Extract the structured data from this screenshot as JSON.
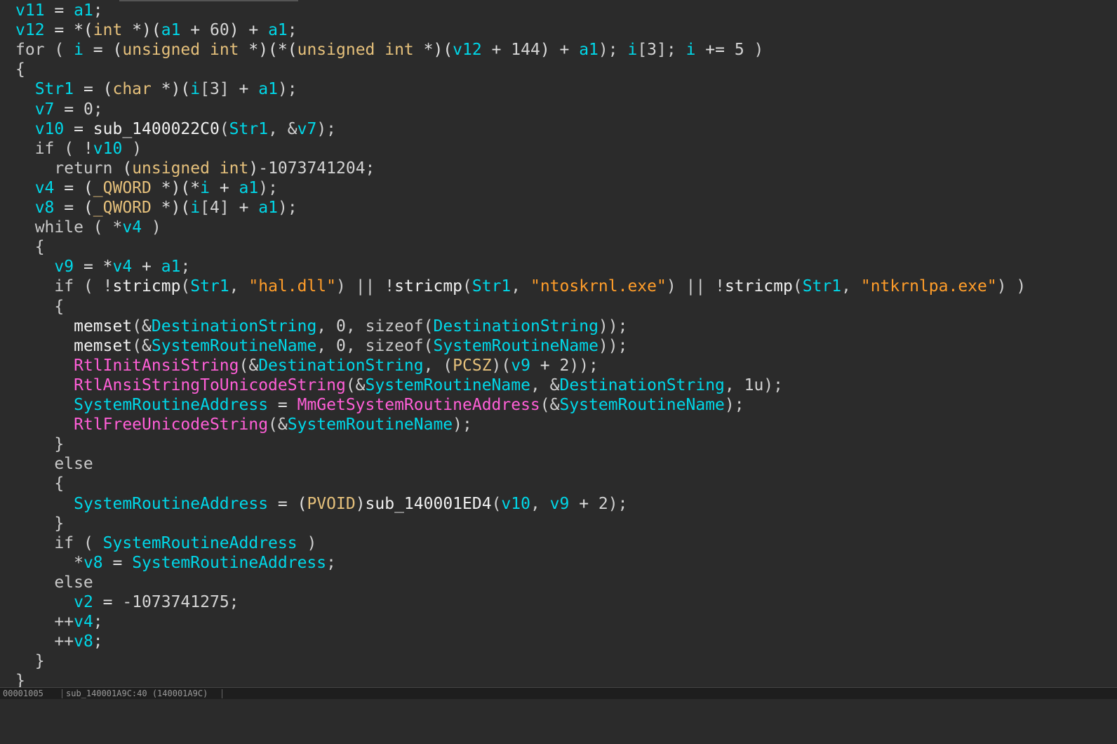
{
  "code_lines": [
    [
      [
        "var",
        "v11"
      ],
      [
        "op",
        " = "
      ],
      [
        "var",
        "a1"
      ],
      [
        "pun",
        ";"
      ]
    ],
    [
      [
        "var",
        "v12"
      ],
      [
        "op",
        " = *("
      ],
      [
        "ty",
        "int"
      ],
      [
        "op",
        " *)("
      ],
      [
        "var",
        "a1"
      ],
      [
        "op",
        " + "
      ],
      [
        "num",
        "60"
      ],
      [
        "op",
        ") + "
      ],
      [
        "var",
        "a1"
      ],
      [
        "pun",
        ";"
      ]
    ],
    [
      [
        "kw",
        "for"
      ],
      [
        "pun",
        " ( "
      ],
      [
        "var",
        "i"
      ],
      [
        "op",
        " = ("
      ],
      [
        "ty",
        "unsigned int"
      ],
      [
        "op",
        " *)(*("
      ],
      [
        "ty",
        "unsigned int"
      ],
      [
        "op",
        " *)("
      ],
      [
        "var",
        "v12"
      ],
      [
        "op",
        " + "
      ],
      [
        "num",
        "144"
      ],
      [
        "op",
        ") + "
      ],
      [
        "var",
        "a1"
      ],
      [
        "pun",
        "); "
      ],
      [
        "var",
        "i"
      ],
      [
        "pun",
        "["
      ],
      [
        "num",
        "3"
      ],
      [
        "pun",
        "]; "
      ],
      [
        "var",
        "i"
      ],
      [
        "op",
        " += "
      ],
      [
        "num",
        "5"
      ],
      [
        "pun",
        " )"
      ]
    ],
    [
      [
        "pun",
        "{"
      ]
    ],
    [
      [
        "pun",
        "  "
      ],
      [
        "var",
        "Str1"
      ],
      [
        "op",
        " = ("
      ],
      [
        "ty",
        "char"
      ],
      [
        "op",
        " *)("
      ],
      [
        "var",
        "i"
      ],
      [
        "pun",
        "["
      ],
      [
        "num",
        "3"
      ],
      [
        "pun",
        "]"
      ],
      [
        "op",
        " + "
      ],
      [
        "var",
        "a1"
      ],
      [
        "pun",
        ");"
      ]
    ],
    [
      [
        "pun",
        "  "
      ],
      [
        "var",
        "v7"
      ],
      [
        "op",
        " = "
      ],
      [
        "num",
        "0"
      ],
      [
        "pun",
        ";"
      ]
    ],
    [
      [
        "pun",
        "  "
      ],
      [
        "var",
        "v10"
      ],
      [
        "op",
        " = "
      ],
      [
        "fn",
        "sub_1400022C0"
      ],
      [
        "pun",
        "("
      ],
      [
        "var",
        "Str1"
      ],
      [
        "pun",
        ", &"
      ],
      [
        "var",
        "v7"
      ],
      [
        "pun",
        ");"
      ]
    ],
    [
      [
        "pun",
        "  "
      ],
      [
        "kw",
        "if"
      ],
      [
        "pun",
        " ( !"
      ],
      [
        "var",
        "v10"
      ],
      [
        "pun",
        " )"
      ]
    ],
    [
      [
        "pun",
        "    "
      ],
      [
        "kw",
        "return"
      ],
      [
        "op",
        " ("
      ],
      [
        "ty",
        "unsigned int"
      ],
      [
        "op",
        ")"
      ],
      [
        "num",
        "-1073741204"
      ],
      [
        "pun",
        ";"
      ]
    ],
    [
      [
        "pun",
        "  "
      ],
      [
        "var",
        "v4"
      ],
      [
        "op",
        " = ("
      ],
      [
        "ty",
        "_QWORD"
      ],
      [
        "op",
        " *)(*"
      ],
      [
        "var",
        "i"
      ],
      [
        "op",
        " + "
      ],
      [
        "var",
        "a1"
      ],
      [
        "pun",
        ");"
      ]
    ],
    [
      [
        "pun",
        "  "
      ],
      [
        "var",
        "v8"
      ],
      [
        "op",
        " = ("
      ],
      [
        "ty",
        "_QWORD"
      ],
      [
        "op",
        " *)("
      ],
      [
        "var",
        "i"
      ],
      [
        "pun",
        "["
      ],
      [
        "num",
        "4"
      ],
      [
        "pun",
        "]"
      ],
      [
        "op",
        " + "
      ],
      [
        "var",
        "a1"
      ],
      [
        "pun",
        ");"
      ]
    ],
    [
      [
        "pun",
        "  "
      ],
      [
        "kw",
        "while"
      ],
      [
        "pun",
        " ( *"
      ],
      [
        "var",
        "v4"
      ],
      [
        "pun",
        " )"
      ]
    ],
    [
      [
        "pun",
        "  {"
      ]
    ],
    [
      [
        "pun",
        "    "
      ],
      [
        "var",
        "v9"
      ],
      [
        "op",
        " = *"
      ],
      [
        "var",
        "v4"
      ],
      [
        "op",
        " + "
      ],
      [
        "var",
        "a1"
      ],
      [
        "pun",
        ";"
      ]
    ],
    [
      [
        "pun",
        "    "
      ],
      [
        "kw",
        "if"
      ],
      [
        "pun",
        " ( !"
      ],
      [
        "fn",
        "stricmp"
      ],
      [
        "pun",
        "("
      ],
      [
        "var",
        "Str1"
      ],
      [
        "pun",
        ", "
      ],
      [
        "str",
        "\"hal.dll\""
      ],
      [
        "pun",
        ") || !"
      ],
      [
        "fn",
        "stricmp"
      ],
      [
        "pun",
        "("
      ],
      [
        "var",
        "Str1"
      ],
      [
        "pun",
        ", "
      ],
      [
        "str",
        "\"ntoskrnl.exe\""
      ],
      [
        "pun",
        ") || !"
      ],
      [
        "fn",
        "stricmp"
      ],
      [
        "pun",
        "("
      ],
      [
        "var",
        "Str1"
      ],
      [
        "pun",
        ", "
      ],
      [
        "str",
        "\"ntkrnlpa.exe\""
      ],
      [
        "pun",
        ") )"
      ]
    ],
    [
      [
        "pun",
        "    {"
      ]
    ],
    [
      [
        "pun",
        "      "
      ],
      [
        "fn",
        "memset"
      ],
      [
        "pun",
        "(&"
      ],
      [
        "var",
        "DestinationString"
      ],
      [
        "pun",
        ", "
      ],
      [
        "num",
        "0"
      ],
      [
        "pun",
        ", "
      ],
      [
        "kw",
        "sizeof"
      ],
      [
        "pun",
        "("
      ],
      [
        "var",
        "DestinationString"
      ],
      [
        "pun",
        "));"
      ]
    ],
    [
      [
        "pun",
        "      "
      ],
      [
        "fn",
        "memset"
      ],
      [
        "pun",
        "(&"
      ],
      [
        "var",
        "SystemRoutineName"
      ],
      [
        "pun",
        ", "
      ],
      [
        "num",
        "0"
      ],
      [
        "pun",
        ", "
      ],
      [
        "kw",
        "sizeof"
      ],
      [
        "pun",
        "("
      ],
      [
        "var",
        "SystemRoutineName"
      ],
      [
        "pun",
        "));"
      ]
    ],
    [
      [
        "pun",
        "      "
      ],
      [
        "api",
        "RtlInitAnsiString"
      ],
      [
        "pun",
        "(&"
      ],
      [
        "var",
        "DestinationString"
      ],
      [
        "pun",
        ", ("
      ],
      [
        "ty",
        "PCSZ"
      ],
      [
        "pun",
        ")("
      ],
      [
        "var",
        "v9"
      ],
      [
        "op",
        " + "
      ],
      [
        "num",
        "2"
      ],
      [
        "pun",
        "));"
      ]
    ],
    [
      [
        "pun",
        "      "
      ],
      [
        "api",
        "RtlAnsiStringToUnicodeString"
      ],
      [
        "pun",
        "(&"
      ],
      [
        "var",
        "SystemRoutineName"
      ],
      [
        "pun",
        ", &"
      ],
      [
        "var",
        "DestinationString"
      ],
      [
        "pun",
        ", "
      ],
      [
        "num",
        "1u"
      ],
      [
        "pun",
        ");"
      ]
    ],
    [
      [
        "pun",
        "      "
      ],
      [
        "var",
        "SystemRoutineAddress"
      ],
      [
        "op",
        " = "
      ],
      [
        "api",
        "MmGetSystemRoutineAddress"
      ],
      [
        "pun",
        "(&"
      ],
      [
        "var",
        "SystemRoutineName"
      ],
      [
        "pun",
        ");"
      ]
    ],
    [
      [
        "pun",
        "      "
      ],
      [
        "api",
        "RtlFreeUnicodeString"
      ],
      [
        "pun",
        "(&"
      ],
      [
        "var",
        "SystemRoutineName"
      ],
      [
        "pun",
        ");"
      ]
    ],
    [
      [
        "pun",
        "    }"
      ]
    ],
    [
      [
        "pun",
        "    "
      ],
      [
        "kw",
        "else"
      ]
    ],
    [
      [
        "pun",
        "    {"
      ]
    ],
    [
      [
        "pun",
        "      "
      ],
      [
        "var",
        "SystemRoutineAddress"
      ],
      [
        "op",
        " = ("
      ],
      [
        "ty",
        "PVOID"
      ],
      [
        "op",
        ")"
      ],
      [
        "fn",
        "sub_140001ED4"
      ],
      [
        "pun",
        "("
      ],
      [
        "var",
        "v10"
      ],
      [
        "pun",
        ", "
      ],
      [
        "var",
        "v9"
      ],
      [
        "op",
        " + "
      ],
      [
        "num",
        "2"
      ],
      [
        "pun",
        ");"
      ]
    ],
    [
      [
        "pun",
        "    }"
      ]
    ],
    [
      [
        "pun",
        "    "
      ],
      [
        "kw",
        "if"
      ],
      [
        "pun",
        " ( "
      ],
      [
        "var",
        "SystemRoutineAddress"
      ],
      [
        "pun",
        " )"
      ]
    ],
    [
      [
        "pun",
        "      *"
      ],
      [
        "var",
        "v8"
      ],
      [
        "op",
        " = "
      ],
      [
        "var",
        "SystemRoutineAddress"
      ],
      [
        "pun",
        ";"
      ]
    ],
    [
      [
        "pun",
        "    "
      ],
      [
        "kw",
        "else"
      ]
    ],
    [
      [
        "pun",
        "      "
      ],
      [
        "var",
        "v2"
      ],
      [
        "op",
        " = "
      ],
      [
        "num",
        "-1073741275"
      ],
      [
        "pun",
        ";"
      ]
    ],
    [
      [
        "pun",
        "    ++"
      ],
      [
        "var",
        "v4"
      ],
      [
        "pun",
        ";"
      ]
    ],
    [
      [
        "pun",
        "    ++"
      ],
      [
        "var",
        "v8"
      ],
      [
        "pun",
        ";"
      ]
    ],
    [
      [
        "pun",
        "  }"
      ]
    ],
    [
      [
        "pun",
        "}"
      ]
    ]
  ],
  "status_bar": {
    "offset": "00001005",
    "location": "sub_140001A9C:40 (140001A9C)"
  },
  "colors": {
    "background": "#2b2b2b",
    "variable": "#00d7e8",
    "type": "#e5c07b",
    "api_call": "#ff5fd7",
    "string": "#ff9d2a",
    "keyword": "#c8c8c8"
  }
}
